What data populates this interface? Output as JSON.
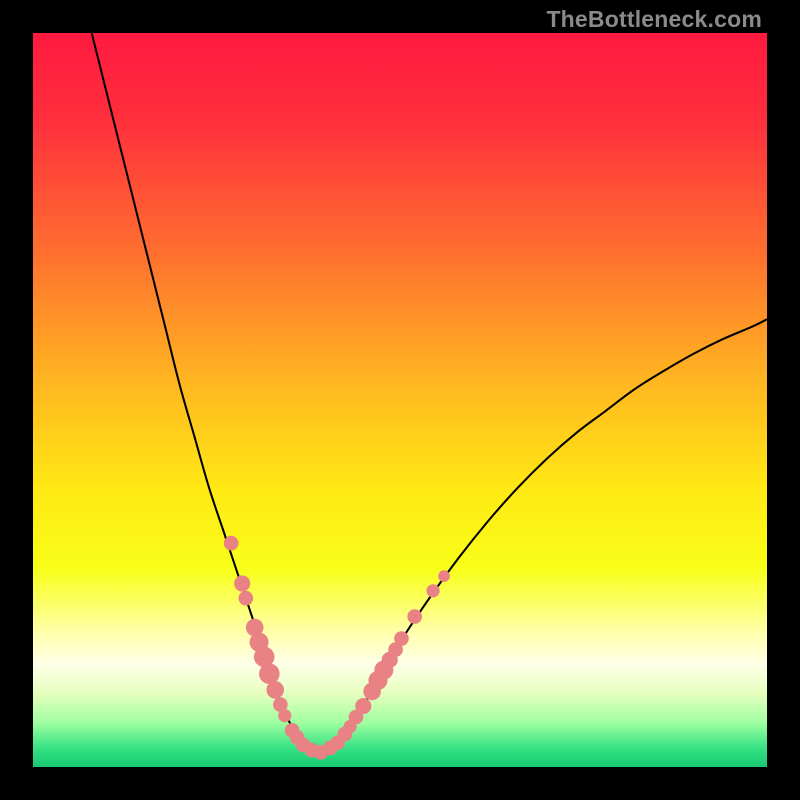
{
  "watermark": "TheBottleneck.com",
  "colors": {
    "frame": "#000000",
    "gradient_stops": [
      {
        "offset": 0.0,
        "color": "#ff1a40"
      },
      {
        "offset": 0.12,
        "color": "#ff2f3c"
      },
      {
        "offset": 0.3,
        "color": "#ff6f30"
      },
      {
        "offset": 0.48,
        "color": "#ffb820"
      },
      {
        "offset": 0.62,
        "color": "#ffe814"
      },
      {
        "offset": 0.73,
        "color": "#f8ff18"
      },
      {
        "offset": 0.82,
        "color": "#ffffb0"
      },
      {
        "offset": 0.86,
        "color": "#ffffe8"
      },
      {
        "offset": 0.9,
        "color": "#e6ffbe"
      },
      {
        "offset": 0.94,
        "color": "#9effa0"
      },
      {
        "offset": 0.975,
        "color": "#34e183"
      },
      {
        "offset": 1.0,
        "color": "#17c872"
      }
    ],
    "curve": "#000000",
    "dot_fill": "#e98284",
    "dot_stroke": "#e98284"
  },
  "chart_data": {
    "type": "line",
    "title": "",
    "xlabel": "",
    "ylabel": "",
    "xlim": [
      0,
      100
    ],
    "ylim": [
      0,
      100
    ],
    "grid": false,
    "legend": false,
    "series": [
      {
        "name": "bottleneck-curve",
        "x": [
          8,
          10,
          12,
          14,
          16,
          18,
          20,
          22,
          24,
          26,
          28,
          30,
          32,
          33,
          34,
          35,
          36,
          37,
          38,
          39,
          40,
          42,
          44,
          46,
          48,
          50,
          54,
          58,
          62,
          66,
          70,
          74,
          78,
          82,
          86,
          90,
          94,
          98,
          100
        ],
        "y": [
          100,
          92,
          84,
          76,
          68,
          60,
          52,
          45,
          38,
          32,
          26,
          20,
          14,
          11,
          8,
          6,
          4,
          3,
          2.2,
          2,
          2.5,
          4,
          7,
          10,
          13.5,
          17,
          23,
          28.5,
          33.5,
          38,
          42,
          45.5,
          48.5,
          51.5,
          54,
          56.3,
          58.3,
          60,
          61
        ]
      }
    ],
    "dots": {
      "name": "highlight-dots",
      "points": [
        {
          "x": 27.0,
          "y": 30.5,
          "r": 1.0
        },
        {
          "x": 28.5,
          "y": 25.0,
          "r": 1.1
        },
        {
          "x": 29.0,
          "y": 23.0,
          "r": 1.0
        },
        {
          "x": 30.2,
          "y": 19.0,
          "r": 1.2
        },
        {
          "x": 30.8,
          "y": 17.0,
          "r": 1.3
        },
        {
          "x": 31.5,
          "y": 15.0,
          "r": 1.4
        },
        {
          "x": 32.2,
          "y": 12.7,
          "r": 1.4
        },
        {
          "x": 33.0,
          "y": 10.5,
          "r": 1.2
        },
        {
          "x": 33.7,
          "y": 8.5,
          "r": 1.0
        },
        {
          "x": 34.3,
          "y": 7.0,
          "r": 0.9
        },
        {
          "x": 35.3,
          "y": 5.0,
          "r": 1.0
        },
        {
          "x": 36.0,
          "y": 4.0,
          "r": 1.0
        },
        {
          "x": 36.8,
          "y": 3.0,
          "r": 1.0
        },
        {
          "x": 38.0,
          "y": 2.3,
          "r": 1.0
        },
        {
          "x": 39.2,
          "y": 2.0,
          "r": 1.0
        },
        {
          "x": 40.5,
          "y": 2.6,
          "r": 1.0
        },
        {
          "x": 41.5,
          "y": 3.3,
          "r": 1.0
        },
        {
          "x": 42.5,
          "y": 4.5,
          "r": 1.0
        },
        {
          "x": 43.2,
          "y": 5.5,
          "r": 0.9
        },
        {
          "x": 44.0,
          "y": 6.8,
          "r": 1.0
        },
        {
          "x": 45.0,
          "y": 8.3,
          "r": 1.1
        },
        {
          "x": 46.2,
          "y": 10.3,
          "r": 1.2
        },
        {
          "x": 47.0,
          "y": 11.8,
          "r": 1.3
        },
        {
          "x": 47.8,
          "y": 13.2,
          "r": 1.3
        },
        {
          "x": 48.6,
          "y": 14.6,
          "r": 1.1
        },
        {
          "x": 49.4,
          "y": 16.0,
          "r": 1.0
        },
        {
          "x": 50.2,
          "y": 17.5,
          "r": 1.0
        },
        {
          "x": 52.0,
          "y": 20.5,
          "r": 1.0
        },
        {
          "x": 54.5,
          "y": 24.0,
          "r": 0.9
        },
        {
          "x": 56.0,
          "y": 26.0,
          "r": 0.8
        }
      ]
    }
  }
}
